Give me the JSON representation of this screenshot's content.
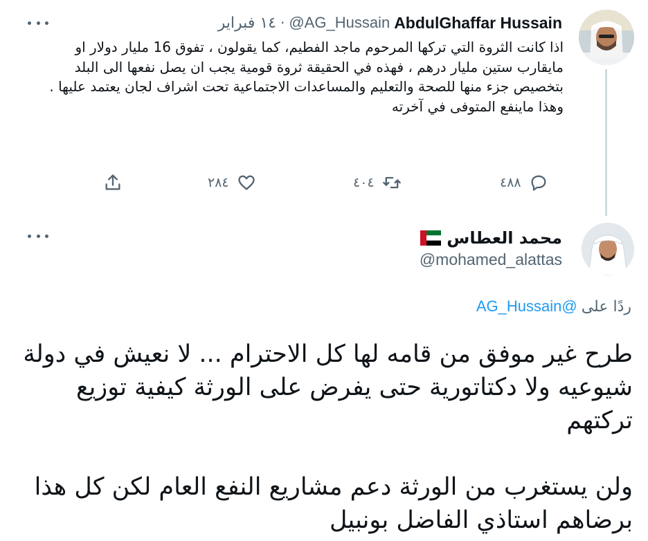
{
  "tweet": {
    "author_name": "AbdulGhaffar Hussain",
    "handle": "@AG_Hussain",
    "separator": "·",
    "date": "١٤ فبراير",
    "text": "اذا كانت الثروة التي تركها المرحوم ماجد الفطيم، كما يقولون ، تفوق 16 مليار دولار او مايقارب ستين مليار درهم ، فهذه في الحقيقة ثروة قومية يجب ان يصل نفعها الى البلد بتخصيص جزء منها للصحة والتعليم والمساعدات الاجتماعية تحت اشراف لجان يعتمد عليها . وهذا ماينفع المتوفى في آخرته",
    "actions": {
      "reply_count": "٤٨٨",
      "retweet_count": "٤٠٤",
      "like_count": "٢٨٤"
    }
  },
  "reply": {
    "author_name": "محمد العطاس",
    "handle": "@mohamed_alattas",
    "reply_label": "ردًا على",
    "reply_to_handle": "@AG_Hussain",
    "paragraph1": "طرح غير موفق من قامه لها كل الاحترام ... لا نعيش في دولة شيوعيه ولا دكتاتورية حتى يفرض على الورثة كيفية توزيع تركتهم",
    "paragraph2": "ولن يستغرب من الورثة دعم مشاريع النفع العام لكن كل هذا برضاهم استاذي الفاضل بونبيل"
  },
  "colors": {
    "text_primary": "#0f1419",
    "text_secondary": "#536471",
    "link": "#1d9bf0",
    "thread_line": "#cfd9de"
  },
  "icons": [
    "more-icon",
    "reply-icon",
    "retweet-icon",
    "like-icon",
    "share-icon",
    "uae-flag-icon"
  ]
}
